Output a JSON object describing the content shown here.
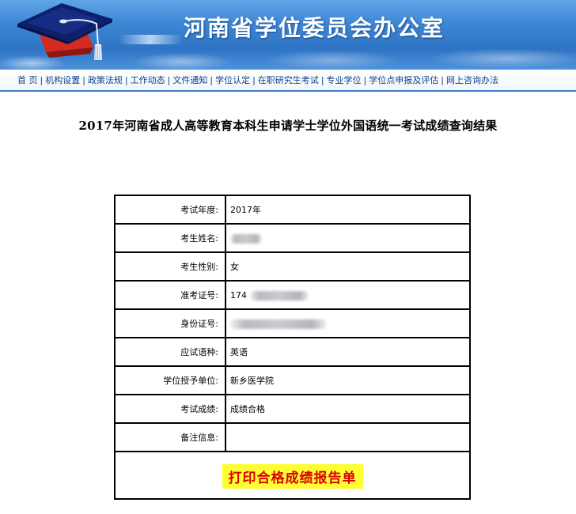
{
  "header": {
    "site_title": "河南省学位委员会办公室"
  },
  "nav": {
    "items": [
      "首 页",
      "机构设置",
      "政策法规",
      "工作动态",
      "文件通知",
      "学位认定",
      "在职研究生考试",
      "专业学位",
      "学位点申报及评估",
      "网上咨询办法"
    ],
    "separator": "|"
  },
  "page_title": "2017年河南省成人高等教育本科生申请学士学位外国语统一考试成绩查询结果",
  "result": {
    "rows": [
      {
        "label": "考试年度:",
        "value": "2017年"
      },
      {
        "label": "考生姓名:",
        "value": ""
      },
      {
        "label": "考生性别:",
        "value": "女"
      },
      {
        "label": "准考证号:",
        "value": "174"
      },
      {
        "label": "身份证号:",
        "value": ""
      },
      {
        "label": "应试语种:",
        "value": "英语"
      },
      {
        "label": "学位授予单位:",
        "value": "新乡医学院"
      },
      {
        "label": "考试成绩:",
        "value": "成绩合格"
      },
      {
        "label": "备注信息:",
        "value": ""
      }
    ],
    "print_button": "打印合格成绩报告单"
  },
  "colors": {
    "banner_blue": "#3d86d4",
    "nav_text": "#0b3f8a",
    "button_bg": "#ffff33",
    "button_text": "#d80000"
  }
}
